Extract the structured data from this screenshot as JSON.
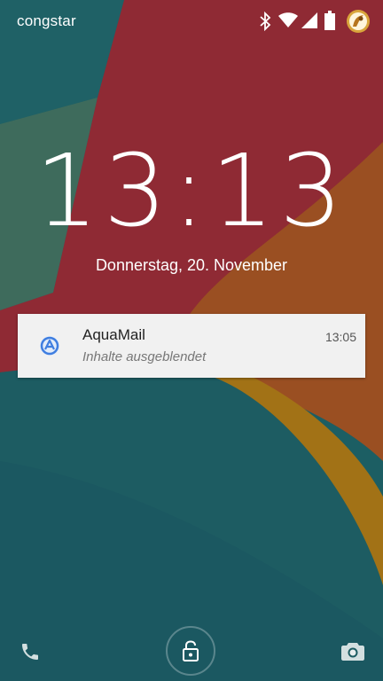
{
  "status_bar": {
    "carrier": "congstar",
    "icons": [
      "bluetooth-icon",
      "wifi-icon",
      "cell-signal-icon",
      "battery-icon",
      "avatar"
    ]
  },
  "lockscreen": {
    "time": "13:13",
    "date": "Donnerstag, 20. November"
  },
  "notification": {
    "app_name": "AquaMail",
    "time": "13:05",
    "text": "Inhalte ausgeblendet",
    "icon": "aquamail-icon"
  },
  "bottom_bar": {
    "left_icon": "phone-icon",
    "center_icon": "lock-icon",
    "right_icon": "camera-icon"
  },
  "colors": {
    "red": "#8e2733",
    "teal": "#1f6a6c",
    "orange": "#9b6a10",
    "accent_blue": "#3f7ee0"
  }
}
